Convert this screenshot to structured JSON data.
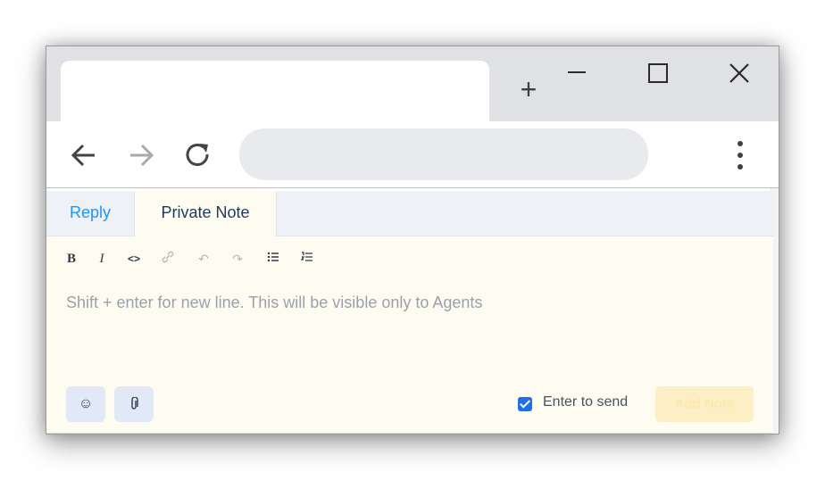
{
  "browser": {
    "new_tab_glyph": "+",
    "icons": {
      "back": "arrow-left-icon",
      "forward": "arrow-right-icon",
      "reload": "reload-icon",
      "menu": "kebab-menu-icon",
      "minimize": "minimize-icon",
      "maximize": "maximize-icon",
      "close": "close-icon"
    }
  },
  "reply_box": {
    "tabs": [
      {
        "label": "Reply",
        "active": false
      },
      {
        "label": "Private Note",
        "active": true
      }
    ],
    "toolbar": [
      {
        "name": "bold-icon",
        "glyph": "B"
      },
      {
        "name": "italic-icon",
        "glyph": "I"
      },
      {
        "name": "code-icon",
        "glyph": "<>"
      },
      {
        "name": "link-icon",
        "glyph": "🔗"
      },
      {
        "name": "undo-icon",
        "glyph": "↶"
      },
      {
        "name": "redo-icon",
        "glyph": "↷"
      },
      {
        "name": "bullet-list-icon",
        "glyph": "☰"
      },
      {
        "name": "numbered-list-icon",
        "glyph": "☷"
      }
    ],
    "placeholder": "Shift + enter for new line. This will be visible only to Agents",
    "emoji_icon": "emoji-icon",
    "attach_icon": "paperclip-icon",
    "enter_to_send": {
      "label": "Enter to send",
      "checked": true
    },
    "submit_label": "Add Note"
  },
  "colors": {
    "accent": "#1f93ff",
    "note_background": "#fefbf0",
    "submit_button": "#fcefc6"
  }
}
